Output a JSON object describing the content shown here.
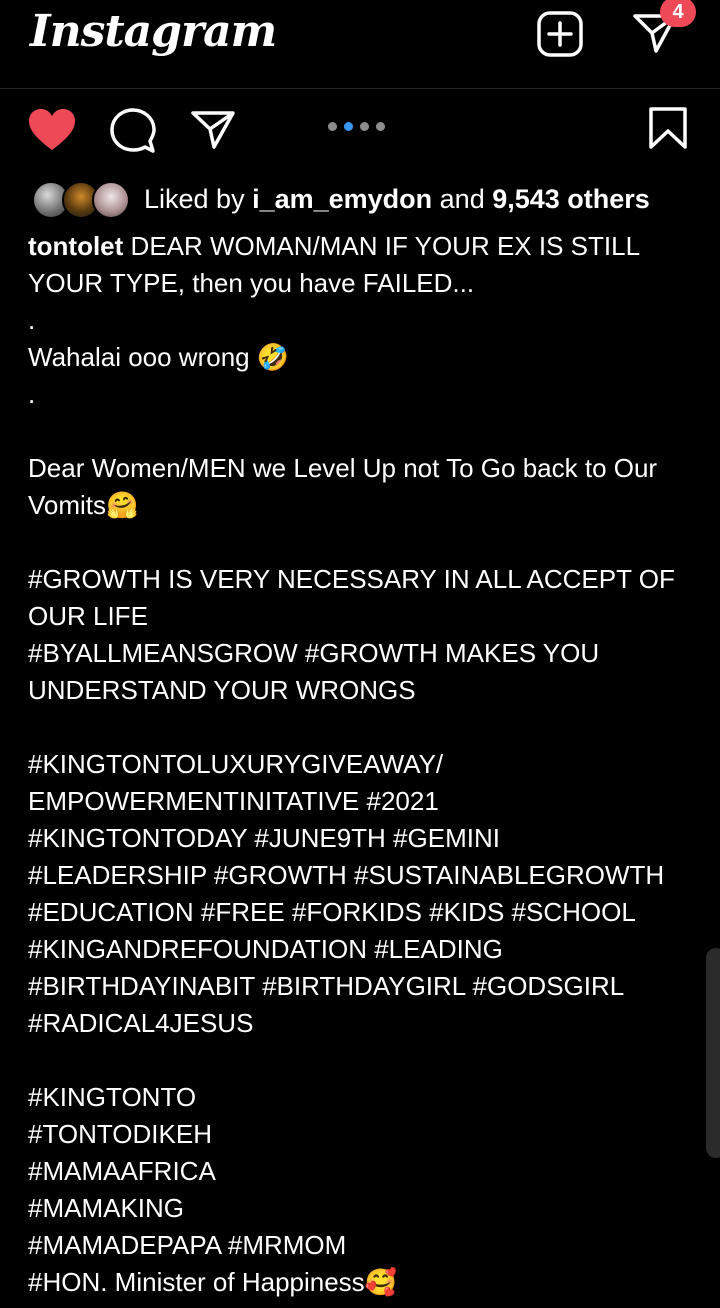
{
  "header": {
    "logo": "Instagram",
    "dm_badge_count": "4"
  },
  "carousel": {
    "total": 4,
    "active_index": 1
  },
  "likes": {
    "prefix": "Liked by ",
    "user": "i_am_emydon",
    "middle": " and ",
    "count": "9,543 others"
  },
  "post": {
    "username": "tontolet",
    "caption": " DEAR WOMAN/MAN IF YOUR EX IS STILL YOUR TYPE, then you have FAILED...\n.\nWahalai ooo wrong 🤣\n.\n\nDear Women/MEN we Level Up not To Go back to Our Vomits🤗\n\n#GROWTH IS VERY NECESSARY IN ALL ACCEPT OF OUR LIFE\n#BYALLMEANSGROW #GROWTH MAKES YOU UNDERSTAND YOUR WRONGS\n\n#KINGTONTOLUXURYGIVEAWAY/ EMPOWERMENTINITATIVE #2021\n#KINGTONTODAY #JUNE9TH #GEMINI\n#LEADERSHIP #GROWTH #SUSTAINABLEGROWTH\n#EDUCATION #FREE #FORKIDS #KIDS #SCHOOL\n#KINGANDREFOUNDATION #LEADING\n#BIRTHDAYINABIT #BIRTHDAYGIRL #GODSGIRL\n#RADICAL4JESUS\n\n#KINGTONTO\n#TONTODIKEH\n#MAMAAFRICA\n#MAMAKING\n#MAMADEPAPA #MRMOM\n#HON. Minister of Happiness🥰"
  },
  "colors": {
    "background": "#000000",
    "like_red": "#ed4956",
    "carousel_active": "#3897f0",
    "text": "#ffffff"
  },
  "icons": [
    "new-post-icon",
    "direct-message-icon",
    "heart-icon",
    "comment-icon",
    "share-icon",
    "bookmark-icon"
  ]
}
